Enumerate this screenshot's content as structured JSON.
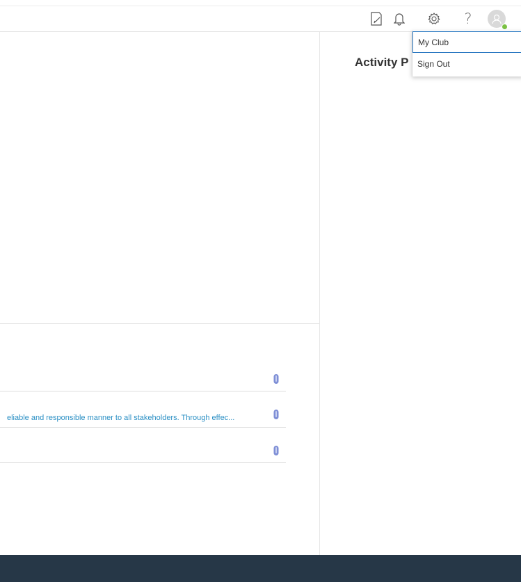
{
  "header": {
    "icons": [
      "notes-icon",
      "bell-icon",
      "gear-icon",
      "help-icon",
      "avatar"
    ],
    "help_label": "?",
    "status_color": "#7ac142"
  },
  "activity_panel": {
    "title": "Activity P"
  },
  "attachments": {
    "rows": [
      {
        "text": ""
      },
      {
        "text": "eliable and responsible manner to all stakeholders. Through effec..."
      },
      {
        "text": ""
      }
    ],
    "link_color": "#2a8fc4",
    "clip_color": "#7f8fd6"
  },
  "user_menu": {
    "items": [
      "My Club",
      "Sign Out"
    ]
  },
  "footer": {
    "color": "#263747"
  }
}
